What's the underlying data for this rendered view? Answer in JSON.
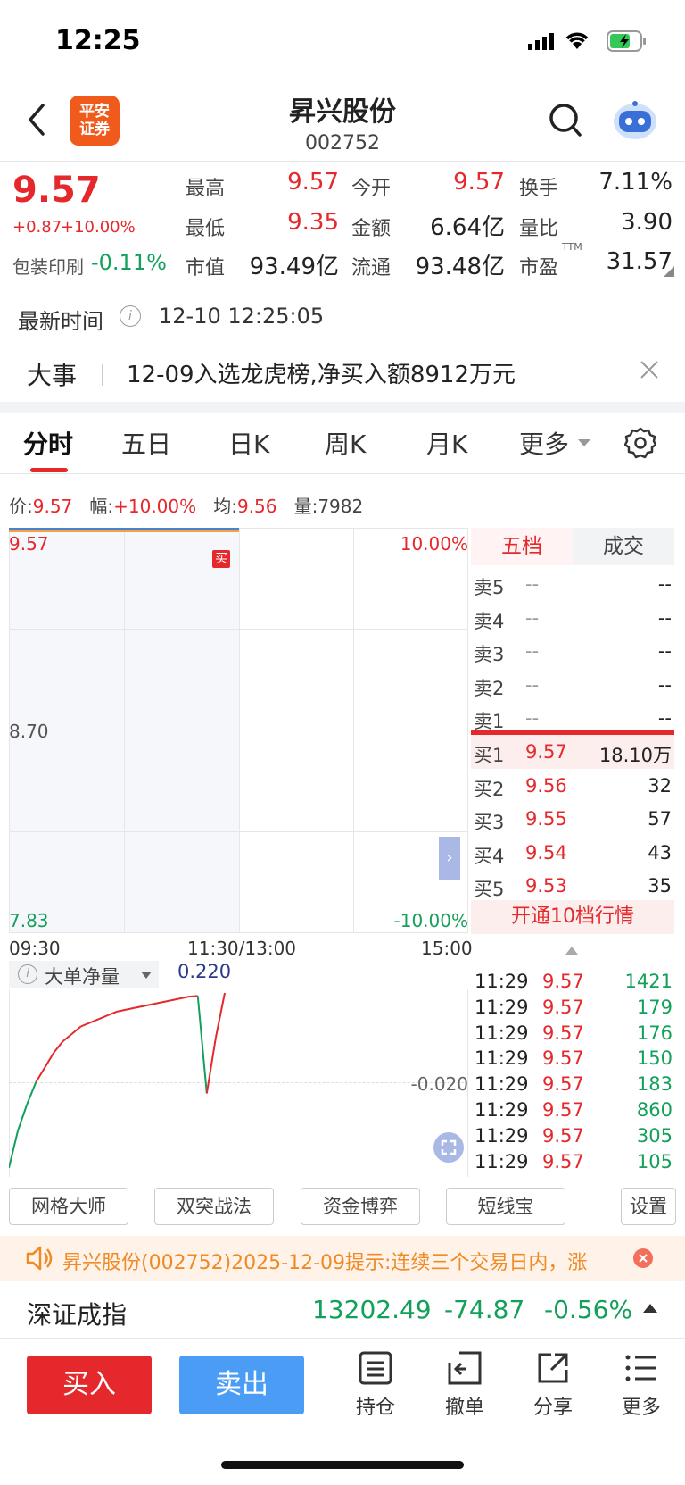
{
  "status_bar": {
    "time": "12:25"
  },
  "header": {
    "logo_text_line1": "平安",
    "logo_text_line2": "证券",
    "title": "昇兴股份",
    "code": "002752"
  },
  "quote": {
    "price": "9.57",
    "change": "+0.87",
    "change_pct": "+10.00%",
    "sector_name": "包装印刷",
    "sector_change": "-0.11%",
    "stats": [
      {
        "label": "最高",
        "value": "9.57",
        "color": "#e5282b"
      },
      {
        "label": "今开",
        "value": "9.57",
        "color": "#e5282b"
      },
      {
        "label": "换手",
        "value": "7.11%",
        "color": "#222222"
      },
      {
        "label": "最低",
        "value": "9.35",
        "color": "#e5282b"
      },
      {
        "label": "金额",
        "value": "6.64亿",
        "color": "#222222"
      },
      {
        "label": "量比",
        "value": "3.90",
        "color": "#222222"
      },
      {
        "label": "市值",
        "value": "93.49亿",
        "color": "#222222"
      },
      {
        "label": "流通",
        "value": "93.48亿",
        "color": "#222222"
      },
      {
        "label": "市盈",
        "value": "31.57",
        "color": "#222222"
      }
    ],
    "pe_superscript": "TTM",
    "latest_time_label": "最新时间",
    "latest_time": "12-10 12:25:05"
  },
  "news": {
    "tag": "大事",
    "text": "12-09入选龙虎榜,净买入额8912万元"
  },
  "tabs": [
    {
      "label": "分时",
      "active": true
    },
    {
      "label": "五日",
      "active": false
    },
    {
      "label": "日K",
      "active": false
    },
    {
      "label": "周K",
      "active": false
    },
    {
      "label": "月K",
      "active": false
    },
    {
      "label": "更多",
      "active": false
    }
  ],
  "info_line": {
    "price_label": "价:",
    "price": "9.57",
    "amp_label": "幅:",
    "amp": "+10.00%",
    "avg_label": "均:",
    "avg": "9.56",
    "vol_label": "量:",
    "vol": "7982"
  },
  "chart_data": {
    "type": "line",
    "title": "",
    "y_axis_left": [
      "9.57",
      "8.70",
      "7.83"
    ],
    "y_axis_right": [
      "10.00%",
      "-10.00%"
    ],
    "x_axis": [
      "09:30",
      "11:30/13:00",
      "15:00"
    ],
    "ylim": [
      7.83,
      9.57
    ],
    "series": [
      {
        "values": [
          9.57,
          9.57,
          9.57,
          9.57,
          9.57
        ],
        "color": "#f2a33a"
      },
      {
        "values": [
          9.57,
          9.57,
          9.57,
          9.57,
          9.57
        ],
        "color": "#4a7fd4"
      }
    ],
    "marker": {
      "label": "买",
      "color": "#e5282b"
    },
    "indicator": {
      "name": "大单净量",
      "value": "0.220",
      "axis_label": "-0.020",
      "points": [
        -0.25,
        -0.15,
        -0.08,
        -0.02,
        0.02,
        0.06,
        0.09,
        0.11,
        0.13,
        0.14,
        0.15,
        0.16,
        0.17,
        0.175,
        0.18,
        0.185,
        0.19,
        0.195,
        0.2,
        0.205,
        0.21,
        0.212,
        -0.05,
        0.1,
        0.22
      ]
    }
  },
  "order_book": {
    "tabs": [
      "五档",
      "成交"
    ],
    "asks": [
      {
        "label": "卖5",
        "price": "--",
        "vol": "--"
      },
      {
        "label": "卖4",
        "price": "--",
        "vol": "--"
      },
      {
        "label": "卖3",
        "price": "--",
        "vol": "--"
      },
      {
        "label": "卖2",
        "price": "--",
        "vol": "--"
      },
      {
        "label": "卖1",
        "price": "--",
        "vol": "--"
      }
    ],
    "bids": [
      {
        "label": "买1",
        "price": "9.57",
        "vol": "18.10万"
      },
      {
        "label": "买2",
        "price": "9.56",
        "vol": "32"
      },
      {
        "label": "买3",
        "price": "9.55",
        "vol": "57"
      },
      {
        "label": "买4",
        "price": "9.54",
        "vol": "43"
      },
      {
        "label": "买5",
        "price": "9.53",
        "vol": "35"
      }
    ],
    "upgrade_label": "开通10档行情"
  },
  "trades": [
    {
      "time": "11:29",
      "price": "9.57",
      "vol": "1421"
    },
    {
      "time": "11:29",
      "price": "9.57",
      "vol": "179"
    },
    {
      "time": "11:29",
      "price": "9.57",
      "vol": "176"
    },
    {
      "time": "11:29",
      "price": "9.57",
      "vol": "150"
    },
    {
      "time": "11:29",
      "price": "9.57",
      "vol": "183"
    },
    {
      "time": "11:29",
      "price": "9.57",
      "vol": "860"
    },
    {
      "time": "11:29",
      "price": "9.57",
      "vol": "305"
    },
    {
      "time": "11:29",
      "price": "9.57",
      "vol": "105"
    }
  ],
  "tools": [
    "网格大师",
    "双突战法",
    "资金博弈",
    "短线宝",
    "设置"
  ],
  "notice": {
    "text": "昇兴股份(002752)2025-12-09提示:连续三个交易日内，涨"
  },
  "index": {
    "name": "深证成指",
    "value": "13202.49",
    "change": "-74.87",
    "change_pct": "-0.56%"
  },
  "actions": {
    "buy": "买入",
    "sell": "卖出",
    "icons": [
      {
        "label": "持仓",
        "icon": "list-icon"
      },
      {
        "label": "撤单",
        "icon": "undo-icon"
      },
      {
        "label": "分享",
        "icon": "share-icon"
      },
      {
        "label": "更多",
        "icon": "more-icon"
      }
    ]
  },
  "colors": {
    "up": "#e5282b",
    "down": "#13a05a",
    "buy_btn": "#e5282b",
    "sell_btn": "#4a9cf5"
  }
}
